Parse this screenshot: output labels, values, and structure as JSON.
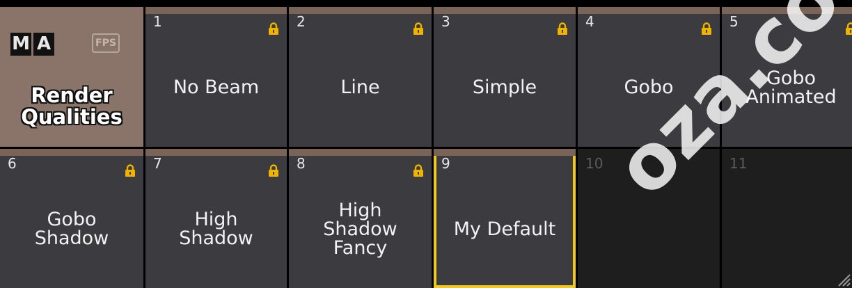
{
  "pool": {
    "logo_letters": [
      "M",
      "A"
    ],
    "fps_label": "FPS",
    "title": "Render\nQualities"
  },
  "items": [
    {
      "number": "1",
      "label": "No Beam",
      "locked": true
    },
    {
      "number": "2",
      "label": "Line",
      "locked": true
    },
    {
      "number": "3",
      "label": "Simple",
      "locked": true
    },
    {
      "number": "4",
      "label": "Gobo",
      "locked": true
    },
    {
      "number": "5",
      "label": "Gobo\nAnimated",
      "locked": true
    },
    {
      "number": "6",
      "label": "Gobo\nShadow",
      "locked": true
    },
    {
      "number": "7",
      "label": "High\nShadow",
      "locked": true
    },
    {
      "number": "8",
      "label": "High\nShadow\nFancy",
      "locked": true
    },
    {
      "number": "9",
      "label": "My Default",
      "locked": false,
      "selected": true
    },
    {
      "number": "10",
      "label": "",
      "empty": true
    },
    {
      "number": "11",
      "label": "",
      "empty": true
    }
  ],
  "watermark": "oza.com",
  "colors": {
    "tile": "#3b3b40",
    "tile_header": "#7a6458",
    "pool_title_bg": "#8a746a",
    "empty_tile": "#1e1e1e",
    "selection": "#f0c81e",
    "lock": "#f0b400"
  },
  "icons": {
    "lock": "lock-icon",
    "resize": "resize-grip-icon"
  }
}
